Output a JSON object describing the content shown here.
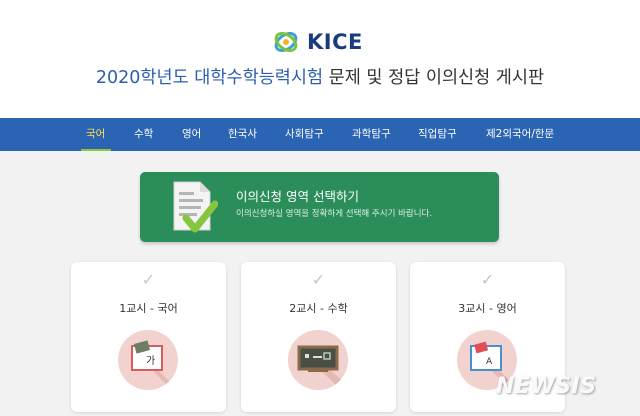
{
  "header": {
    "logo_text": "KICE",
    "title_accent": "2020학년도 대학수학능력시험",
    "title_rest": " 문제 및 정답 이의신청 게시판"
  },
  "nav": {
    "items": [
      {
        "label": "국어",
        "active": true
      },
      {
        "label": "수학",
        "active": false
      },
      {
        "label": "영어",
        "active": false
      },
      {
        "label": "한국사",
        "active": false
      },
      {
        "label": "사회탐구",
        "active": false
      },
      {
        "label": "과학탐구",
        "active": false
      },
      {
        "label": "직업탐구",
        "active": false
      },
      {
        "label": "제2외국어/한문",
        "active": false
      }
    ],
    "active_color": "#ffe04a",
    "bar_color": "#2b64b3"
  },
  "banner": {
    "title": "이의신청 영역 선택하기",
    "subtitle": "이의신청하실 영역을 정확하게 선택해 주시기 바랍니다.",
    "color": "#2b8e5a",
    "icon": "document-check-icon"
  },
  "cards": [
    {
      "label": "1교시 - 국어",
      "icon": "korean-book-icon"
    },
    {
      "label": "2교시 - 수학",
      "icon": "chalkboard-icon"
    },
    {
      "label": "3교시 - 영어",
      "icon": "english-book-icon"
    }
  ],
  "watermark": "NEWSIS"
}
